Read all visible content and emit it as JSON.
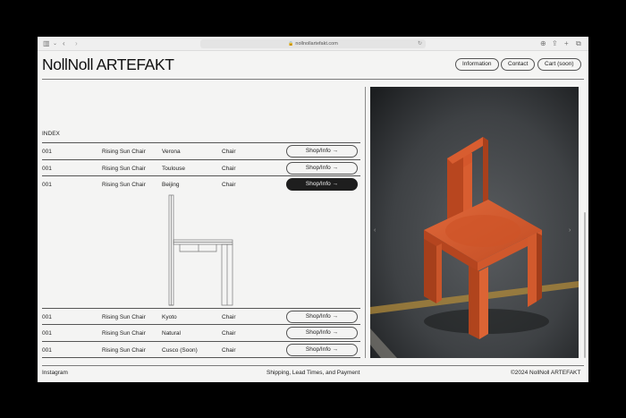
{
  "browser": {
    "url": "nollnollartefakt.com",
    "icons": [
      "sidebar-icon",
      "chevron-down-icon",
      "back-icon",
      "forward-icon",
      "lock-icon",
      "reload-icon",
      "download-icon",
      "share-icon",
      "plus-icon",
      "tabs-icon"
    ]
  },
  "header": {
    "logo": "NollNoll ARTEFAKT",
    "nav": [
      {
        "label": "Information"
      },
      {
        "label": "Contact"
      },
      {
        "label": "Cart (soon)"
      }
    ]
  },
  "index": {
    "label": "INDEX",
    "rows": [
      {
        "num": "001",
        "name": "Rising Sun Chair",
        "location": "Verona",
        "type": "Chair",
        "action": "Shop/Info →",
        "active": false
      },
      {
        "num": "001",
        "name": "Rising Sun Chair",
        "location": "Toulouse",
        "type": "Chair",
        "action": "Shop/Info →",
        "active": false
      },
      {
        "num": "001",
        "name": "Rising Sun Chair",
        "location": "Beijing",
        "type": "Chair",
        "action": "Shop/Info →",
        "active": true
      },
      {
        "num": "001",
        "name": "Rising Sun Chair",
        "location": "Kyoto",
        "type": "Chair",
        "action": "Shop/Info →",
        "active": false
      },
      {
        "num": "001",
        "name": "Rising Sun Chair",
        "location": "Natural",
        "type": "Chair",
        "action": "Shop/Info →",
        "active": false
      },
      {
        "num": "001",
        "name": "Rising Sun Chair",
        "location": "Cusco (Soon)",
        "type": "Chair",
        "action": "Shop/Info →",
        "active": false
      }
    ]
  },
  "photo": {
    "colors": {
      "chair": "#d4572c",
      "floor": "#3e4144",
      "stripe": "#b08a3a"
    }
  },
  "footer": {
    "left": "Instagram",
    "center": "Shipping, Lead Times, and Payment",
    "right": "©2024 NollNoll ARTEFAKT"
  }
}
